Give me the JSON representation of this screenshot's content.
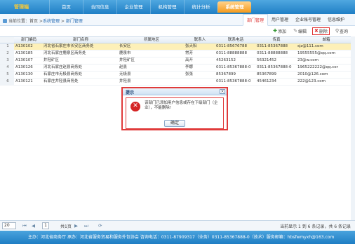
{
  "app": {
    "brand": "管理端"
  },
  "nav": [
    "首页",
    "合同信息",
    "企业管理",
    "机构管理",
    "统计分析",
    "系统管理"
  ],
  "breadcrumb": {
    "prefix": "当前位置：首页 >",
    "section": "系统管理",
    "sep": " > ",
    "page": "部门管理"
  },
  "subtabs": [
    "部门管理",
    "用户管理",
    "企业账号管理",
    "信息维护"
  ],
  "toolbar": {
    "add": "添加",
    "edit": "编辑",
    "delete": "删除",
    "query": "查询"
  },
  "table": {
    "headers": [
      "部门编码",
      "部门名称",
      "所属地区",
      "联系人",
      "联系电话",
      "传真",
      "邮箱"
    ],
    "rows": [
      [
        "1",
        "A130102",
        "河北省石家庄市长安区商务处",
        "长安区",
        "张天阳",
        "0311-85676788",
        "0311-85367888",
        "sjz@111.com"
      ],
      [
        "2",
        "A130185",
        "河北石家庄鹿泉区商务处",
        "鹿泉市",
        "常芳",
        "0311-88888888",
        "0311-88888888",
        "19555555@qq.com"
      ],
      [
        "3",
        "A130107",
        "井陉矿区",
        "井陉矿区",
        "高开",
        "45263152",
        "56321452",
        "23@w.com"
      ],
      [
        "4",
        "A130126",
        "河北石家庄赵县商务处",
        "赵县",
        "李娜",
        "0311-85367888-0",
        "0311-85367888-0",
        "1965222222@qq.cor"
      ],
      [
        "5",
        "A130130",
        "石家庄市无极县商务处",
        "无极县",
        "张张",
        "85367899",
        "85367899",
        "2010@126.com"
      ],
      [
        "6",
        "A130121",
        "石家庄井陉县商务处",
        "井陉县",
        "",
        "0311-85367888-0",
        "45461234",
        "222@123.com"
      ]
    ]
  },
  "pager": {
    "page_size": "20",
    "page_num": "1",
    "of_pages": "共1页",
    "info": "当前显示 1 到 6 条记录，共 6 条记录"
  },
  "dialog": {
    "title": "提示",
    "message": "该部门已添加用户信息或存在下级部门（企业），不能删除!",
    "ok": "确定"
  },
  "footer": "主办：河北省商务厅  承办：河北省服务贸易和服务外包协会  咨询电话：0311-87909317（业务）0311-85367888-0（技术）服务邮箱：hbsfwmyxh@163.com"
}
